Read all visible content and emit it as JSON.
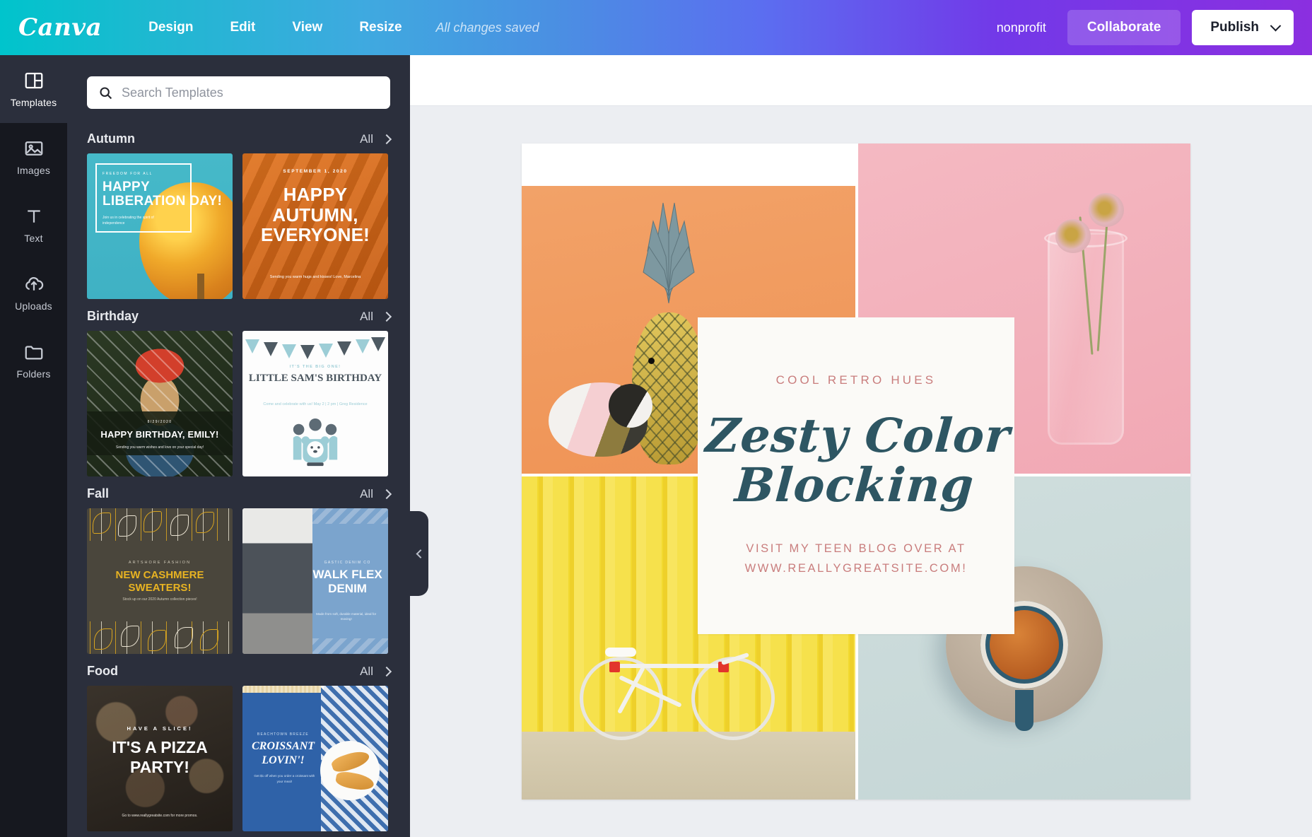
{
  "topbar": {
    "logo": "Canva",
    "menu": [
      {
        "label": "Design"
      },
      {
        "label": "Edit"
      },
      {
        "label": "View"
      },
      {
        "label": "Resize"
      }
    ],
    "save_status": "All changes saved",
    "account_name": "nonprofit",
    "collaborate_label": "Collaborate",
    "publish_label": "Publish",
    "gradient_start": "#00c4cc",
    "gradient_end": "#8b2fe0"
  },
  "rail": {
    "items": [
      {
        "label": "Templates",
        "icon": "templates-icon",
        "active": true
      },
      {
        "label": "Images",
        "icon": "images-icon",
        "active": false
      },
      {
        "label": "Text",
        "icon": "text-icon",
        "active": false
      },
      {
        "label": "Uploads",
        "icon": "uploads-icon",
        "active": false
      },
      {
        "label": "Folders",
        "icon": "folders-icon",
        "active": false
      }
    ]
  },
  "panel": {
    "background": "#2b2f3c",
    "search": {
      "placeholder": "Search Templates",
      "value": "",
      "icon": "search-icon"
    },
    "all_label": "All",
    "categories": [
      {
        "title": "Autumn",
        "all_label": "All",
        "templates": [
          {
            "name": "happy-liberation-day",
            "kicker": "FREEDOM FOR ALL",
            "headline": "HAPPY LIBERATION DAY!",
            "sub": "Join us in celebrating the spirit of independence"
          },
          {
            "name": "happy-autumn-everyone",
            "date": "SEPTEMBER 1, 2020",
            "headline": "HAPPY AUTUMN, EVERYONE!",
            "sub": "Sending you warm hugs and kisses! Love, Marcelina"
          }
        ]
      },
      {
        "title": "Birthday",
        "all_label": "All",
        "templates": [
          {
            "name": "happy-birthday-emily",
            "kicker": "8/29/2020",
            "headline": "HAPPY BIRTHDAY, EMILY!",
            "sub": "Sending you warm wishes and love on your special day!"
          },
          {
            "name": "little-sams-birthday",
            "kicker": "IT'S THE BIG ONE!",
            "headline": "LITTLE SAM'S BIRTHDAY",
            "sub": "Come and celebrate with us! May 2 | 2 pm | Greg Residence"
          }
        ]
      },
      {
        "title": "Fall",
        "all_label": "All",
        "templates": [
          {
            "name": "new-cashmere-sweaters",
            "kicker": "ARTSHORE FASHION",
            "headline": "NEW CASHMERE SWEATERS!",
            "sub": "Stock up on our 2020 Autumn collection pieces!"
          },
          {
            "name": "walk-flex-denim",
            "kicker": "GASTIC DENIM CO",
            "headline": "WALK FLEX DENIM",
            "sub": "Made from soft, durable material, ideal for moving!"
          }
        ]
      },
      {
        "title": "Food",
        "all_label": "All",
        "templates": [
          {
            "name": "its-a-pizza-party",
            "kicker": "HAVE A SLICE!",
            "headline": "IT'S A PIZZA PARTY!",
            "sub": "Go to www.reallygreatsite.com for more promos."
          },
          {
            "name": "croissant-lovin",
            "kicker": "BEACHTOWN BREEZE",
            "headline": "CROISSANT LOVIN'!",
            "sub": "Get $1 off when you order a croissant with your meal!"
          }
        ]
      }
    ]
  },
  "canvas": {
    "design_name": "zesty-color-blocking",
    "quadrants": [
      {
        "name": "orange-pineapple-guinea-pig",
        "color": "#ef9355"
      },
      {
        "name": "pink-flower-jar",
        "color": "#f1a8b4"
      },
      {
        "name": "yellow-wall-bicycle",
        "color": "#f2d92f"
      },
      {
        "name": "blue-grey-coffee-cup",
        "color": "#c5d6d6"
      }
    ],
    "text_card": {
      "kicker": "COOL RETRO HUES",
      "title_line_1": "Zesty Color",
      "title_line_2": "Blocking",
      "footer_line_1": "VISIT MY TEEN BLOG OVER AT",
      "footer_line_2": "WWW.REALLYGREATSITE.COM!",
      "kicker_color": "#c97d7d",
      "title_color": "#2e5663",
      "card_background": "#fbfaf7"
    }
  },
  "collapse_handle": {
    "icon": "chevron-left-icon"
  }
}
